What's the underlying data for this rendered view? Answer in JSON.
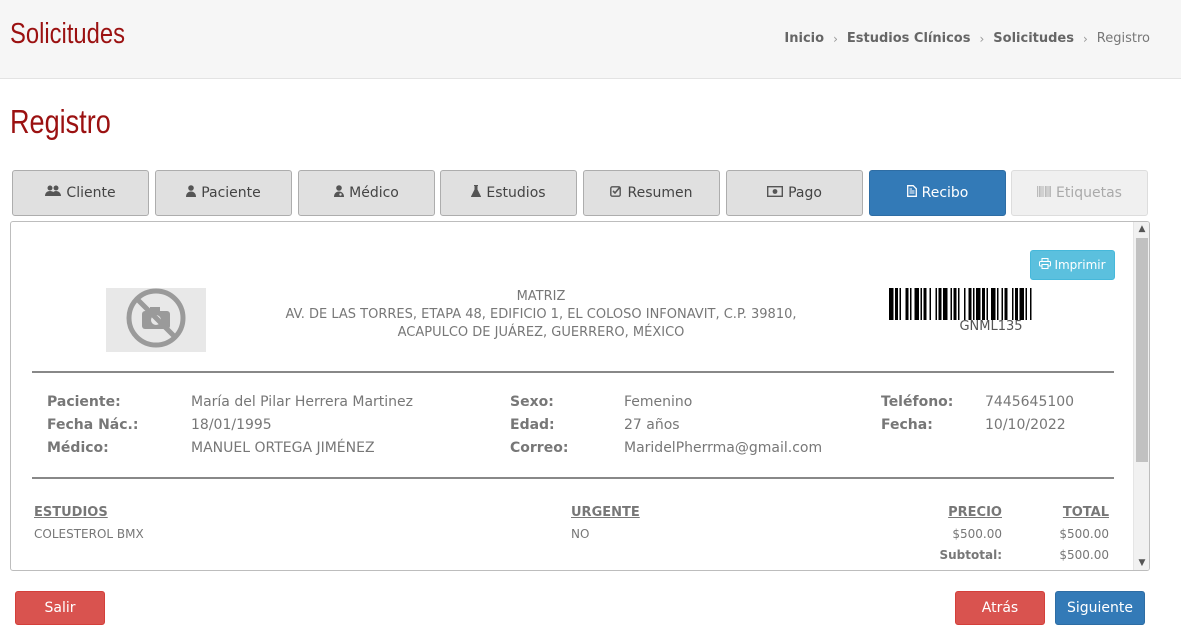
{
  "header": {
    "title": "Solicitudes",
    "breadcrumb": [
      "Inicio",
      "Estudios Clínicos",
      "Solicitudes",
      "Registro"
    ]
  },
  "page_title": "Registro",
  "tabs": [
    {
      "label": "Cliente",
      "icon": "users-icon",
      "state": "normal"
    },
    {
      "label": "Paciente",
      "icon": "user-icon",
      "state": "normal"
    },
    {
      "label": "Médico",
      "icon": "user-md-icon",
      "state": "normal"
    },
    {
      "label": "Estudios",
      "icon": "flask-icon",
      "state": "normal"
    },
    {
      "label": "Resumen",
      "icon": "check-square-icon",
      "state": "normal"
    },
    {
      "label": "Pago",
      "icon": "money-icon",
      "state": "normal"
    },
    {
      "label": "Recibo",
      "icon": "file-text-icon",
      "state": "active"
    },
    {
      "label": "Etiquetas",
      "icon": "barcode-icon",
      "state": "disabled"
    }
  ],
  "receipt": {
    "print_label": "Imprimir",
    "address_lines": [
      "MATRIZ",
      "AV. DE LAS TORRES, ETAPA 48, EDIFICIO 1, EL COLOSO INFONAVIT, C.P. 39810,",
      "ACAPULCO DE JUÁREZ, GUERRERO, MÉXICO"
    ],
    "barcode_text": "GNML135",
    "patient": {
      "paciente_label": "Paciente:",
      "paciente": "María del Pilar Herrera Martinez",
      "fecha_nac_label": "Fecha Nác.:",
      "fecha_nac": "18/01/1995",
      "medico_label": "Médico:",
      "medico": "MANUEL ORTEGA JIMÉNEZ",
      "sexo_label": "Sexo:",
      "sexo": "Femenino",
      "edad_label": "Edad:",
      "edad": "27 años",
      "correo_label": "Correo:",
      "correo": "MaridelPherrma@gmail.com",
      "telefono_label": "Teléfono:",
      "telefono": "7445645100",
      "fecha_label": "Fecha:",
      "fecha": "10/10/2022"
    },
    "table": {
      "headers": {
        "estudios": "ESTUDIOS",
        "urgente": "URGENTE",
        "precio": "PRECIO",
        "total": "TOTAL"
      },
      "rows": [
        {
          "estudio": "COLESTEROL BMX",
          "urgente": "NO",
          "precio": "$500.00",
          "total": "$500.00"
        }
      ],
      "subtotal_label": "Subtotal:",
      "subtotal": "$500.00"
    }
  },
  "footer": {
    "exit_label": "Salir",
    "back_label": "Atrás",
    "next_label": "Siguiente"
  },
  "colors": {
    "accent": "#9b1111",
    "primary": "#337ab7",
    "danger": "#d9534f",
    "info": "#5bc0de"
  }
}
